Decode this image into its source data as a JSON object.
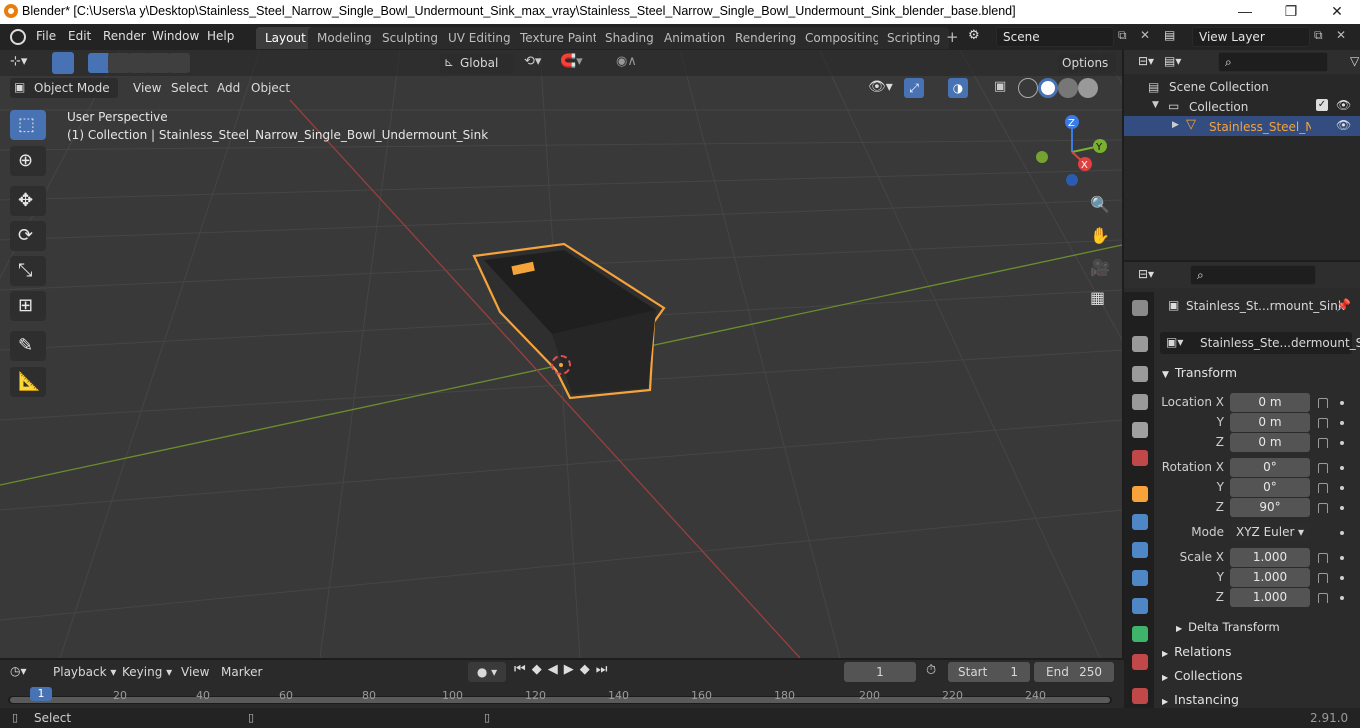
{
  "window": {
    "title": "Blender* [C:\\Users\\a y\\Desktop\\Stainless_Steel_Narrow_Single_Bowl_Undermount_Sink_max_vray\\Stainless_Steel_Narrow_Single_Bowl_Undermount_Sink_blender_base.blend]",
    "minimize": "—",
    "maximize": "❐",
    "close": "✕"
  },
  "menu": {
    "file": "File",
    "edit": "Edit",
    "render": "Render",
    "window": "Window",
    "help": "Help"
  },
  "workspaces": [
    "Layout",
    "Modeling",
    "Sculpting",
    "UV Editing",
    "Texture Paint",
    "Shading",
    "Animation",
    "Rendering",
    "Compositing",
    "Scripting"
  ],
  "scene": {
    "label": "Scene",
    "view_layer": "View Layer"
  },
  "viewport": {
    "transform": "Global",
    "options": "Options",
    "mode": "Object Mode",
    "view": "View",
    "select": "Select",
    "add": "Add",
    "object": "Object",
    "perspective": "User Perspective",
    "collection_info": "(1) Collection | Stainless_Steel_Narrow_Single_Bowl_Undermount_Sink",
    "gizmo": {
      "x": "X",
      "y": "Y",
      "z": "Z"
    }
  },
  "outliner": {
    "scene_collection": "Scene Collection",
    "collection": "Collection",
    "object": "Stainless_Steel_Narr"
  },
  "properties": {
    "object_name": "Stainless_St...rmount_Sink",
    "data_name": "Stainless_Ste...dermount_Sink",
    "transform_header": "Transform",
    "location_label": "Location X",
    "rotation_label": "Rotation X",
    "scale_label": "Scale X",
    "y_label": "Y",
    "z_label": "Z",
    "location": [
      "0 m",
      "0 m",
      "0 m"
    ],
    "rotation": [
      "0°",
      "0°",
      "90°"
    ],
    "mode_label": "Mode",
    "mode": "XYZ Euler",
    "scale": [
      "1.000",
      "1.000",
      "1.000"
    ],
    "delta": "Delta Transform",
    "relations": "Relations",
    "collections": "Collections",
    "instancing": "Instancing"
  },
  "timeline": {
    "playback": "Playback",
    "keying": "Keying",
    "view": "View",
    "marker": "Marker",
    "current_frame": "1",
    "start_label": "Start",
    "start": "1",
    "end_label": "End",
    "end": "250",
    "ticks": [
      "1",
      "20",
      "40",
      "60",
      "80",
      "100",
      "120",
      "140",
      "160",
      "180",
      "200",
      "220",
      "240"
    ]
  },
  "status": {
    "select": "Select",
    "version": "2.91.0"
  }
}
